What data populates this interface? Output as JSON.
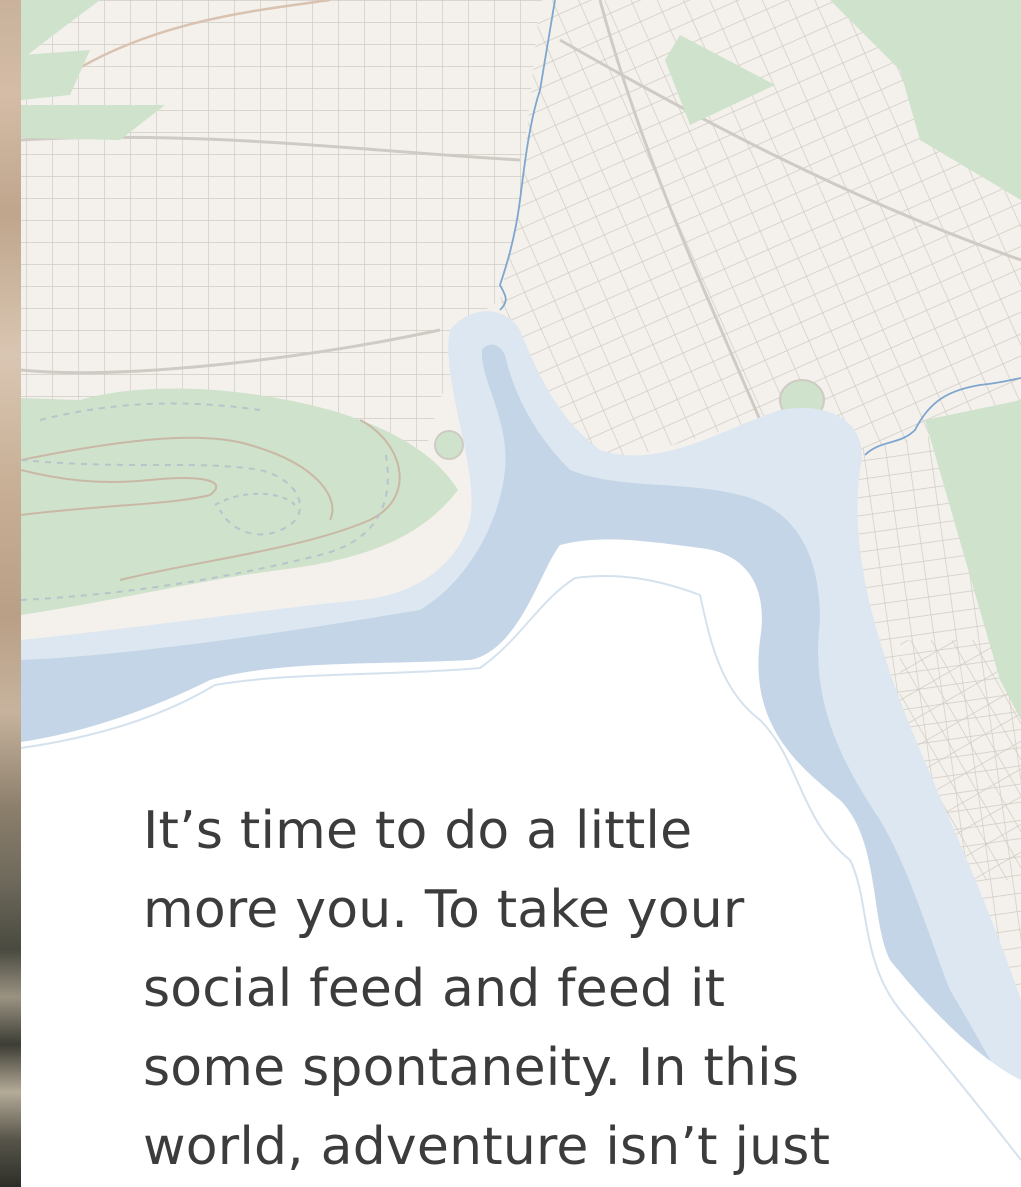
{
  "copy": {
    "lines": [
      "It’s time to do a little",
      "more you. To take your",
      "social feed and feed it",
      "some spontaneity. In this",
      "world, adventure isn’t just"
    ]
  },
  "colors": {
    "land": "#f4f1ec",
    "street": "#cfcac4",
    "park": "#cfe2cb",
    "water_shallow": "#dce7f1",
    "water_deep": "#c3d5e6",
    "river_line": "#7ea6cf",
    "text": "#3c3c3c"
  }
}
